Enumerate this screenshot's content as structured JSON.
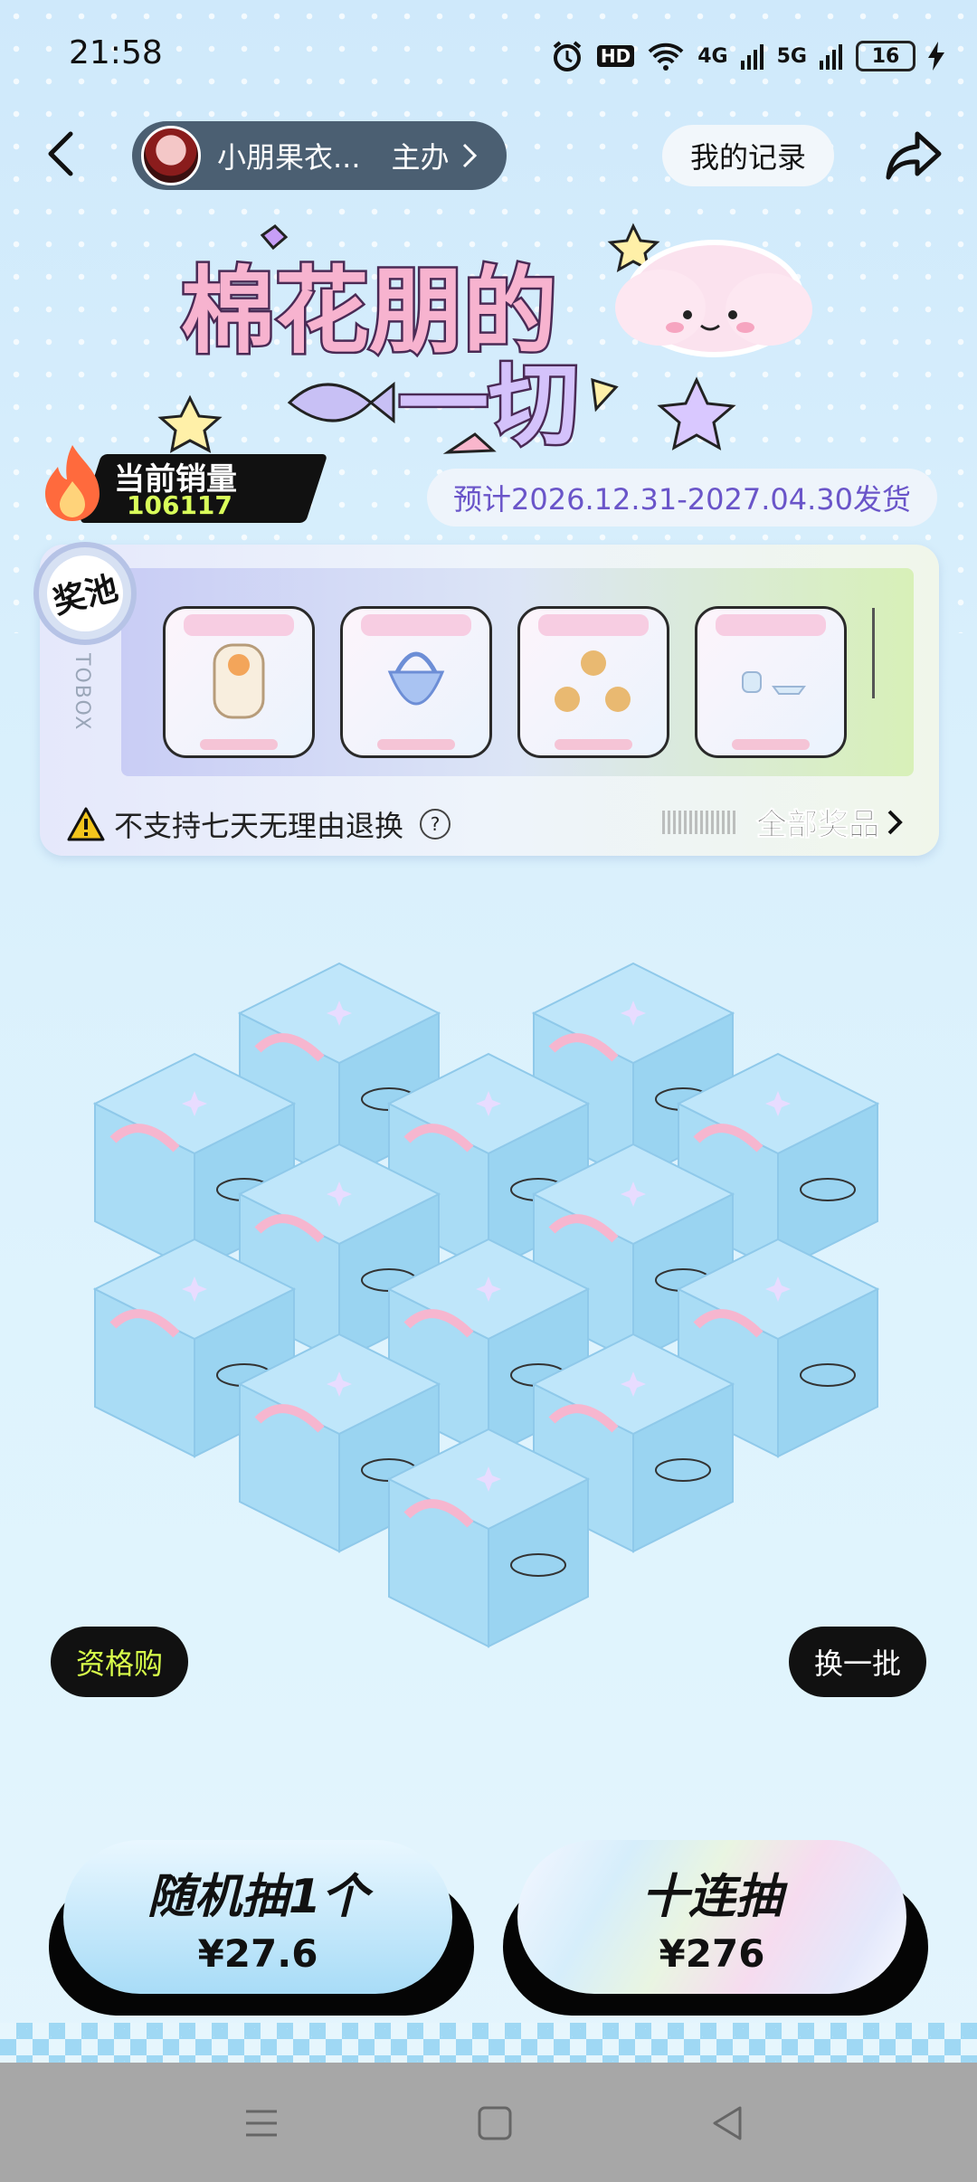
{
  "status": {
    "time": "21:58",
    "hd": "HD",
    "net1": "4G",
    "net2": "5G",
    "battery": "16"
  },
  "header": {
    "shop_name": "小朋果衣...",
    "host_label": "主办",
    "records_label": "我的记录"
  },
  "banner": {
    "title_line1": "棉花朋的",
    "title_line2": "一切"
  },
  "sales": {
    "label": "当前销量",
    "count": "106117"
  },
  "shipping": "预计2026.12.31-2027.04.30发货",
  "pool": {
    "badge": "奖池",
    "notice": "不支持七天无理由退换",
    "help": "?",
    "all_label": "全部奖品",
    "side_text": "TOBOX",
    "items_visible": 4
  },
  "actions": {
    "qualify_label": "资格购",
    "swap_label": "换一批"
  },
  "draw": {
    "single_title": "随机抽1个",
    "single_price": "¥27.6",
    "ten_title": "十连抽",
    "ten_price": "¥276"
  },
  "colors": {
    "accent": "#d8ff4a",
    "box_blue": "#a9dcf5",
    "ship_text": "#6a55c9"
  },
  "icons": [
    "back-arrow-icon",
    "share-icon",
    "alarm-icon",
    "wifi-icon",
    "signal-icon",
    "battery-icon",
    "fire-icon",
    "warning-icon",
    "menu-icon",
    "home-icon",
    "back-triangle-icon"
  ]
}
